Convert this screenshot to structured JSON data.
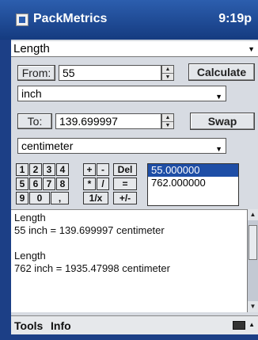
{
  "titlebar": {
    "app_title": "PackMetrics",
    "clock": "9:19p"
  },
  "category": {
    "value": "Length"
  },
  "from": {
    "label": "From:",
    "value": "55"
  },
  "calculate_label": "Calculate",
  "from_unit": "inch",
  "to": {
    "label": "To:",
    "value": "139.699997"
  },
  "swap_label": "Swap",
  "to_unit": "centimeter",
  "keypad": {
    "row1": [
      "1",
      "2",
      "3",
      "4"
    ],
    "row2": [
      "5",
      "6",
      "7",
      "8"
    ],
    "row3": [
      "9",
      "0",
      ",",
      "1/x"
    ],
    "ops_row1": [
      "+",
      "-",
      "Del"
    ],
    "ops_row2": [
      "*",
      "/",
      "="
    ],
    "ops_row3": [
      "+/-"
    ]
  },
  "history_list": [
    "55.000000",
    "762.000000"
  ],
  "results": [
    {
      "heading": "Length",
      "line": "55 inch = 139.699997 centimeter"
    },
    {
      "heading": "Length",
      "line": "762 inch = 1935.47998 centimeter"
    }
  ],
  "menubar": {
    "tools": "Tools",
    "info": "Info"
  }
}
